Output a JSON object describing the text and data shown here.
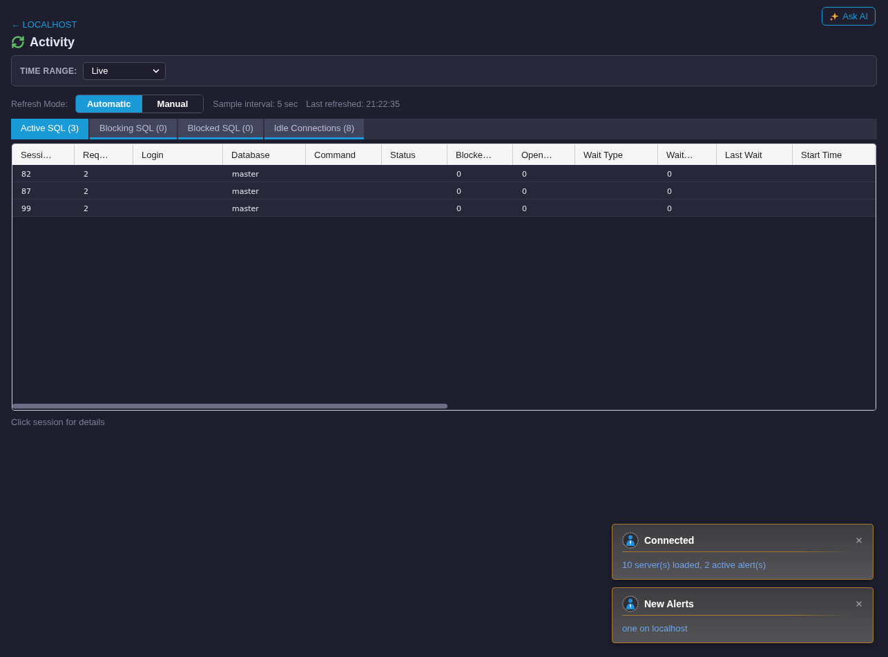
{
  "header": {
    "back_link": "← LOCALHOST",
    "title": "Activity",
    "ask_ai": "Ask AI"
  },
  "time_range": {
    "label": "TIME RANGE:",
    "value": "Live"
  },
  "refresh": {
    "label": "Refresh Mode:",
    "modes": [
      {
        "label": "Automatic",
        "selected": true
      },
      {
        "label": "Manual",
        "selected": false
      }
    ],
    "sample_interval": "Sample interval: 5 sec",
    "last_refreshed": "Last refreshed: 21:22:35"
  },
  "tabs": [
    {
      "label": "Active SQL (3)",
      "selected": true
    },
    {
      "label": "Blocking SQL (0)",
      "selected": false
    },
    {
      "label": "Blocked SQL (0)",
      "selected": false
    },
    {
      "label": "Idle Connections (8)",
      "selected": false
    }
  ],
  "table": {
    "columns": [
      "Sessi…",
      "Req…",
      "Login",
      "Database",
      "Command",
      "Status",
      "Blocke…",
      "Open…",
      "Wait Type",
      "Wait…",
      "Last Wait",
      "Start Time"
    ],
    "rows": [
      {
        "column_1": "82",
        "column_2": "2",
        "column_4": "master",
        "column_7": "0",
        "column_8": "0",
        "column_10": "0"
      },
      {
        "column_1": "87",
        "column_2": "2",
        "column_4": "master",
        "column_7": "0",
        "column_8": "0",
        "column_10": "0"
      },
      {
        "column_1": "99",
        "column_2": "2",
        "column_4": "master",
        "column_7": "0",
        "column_8": "0",
        "column_10": "0"
      }
    ]
  },
  "hint": "Click session for details",
  "toasts": [
    {
      "title": "Connected",
      "message": "10 server(s) loaded, 2 active alert(s)"
    },
    {
      "title": "New Alerts",
      "message": "one on localhost"
    }
  ]
}
